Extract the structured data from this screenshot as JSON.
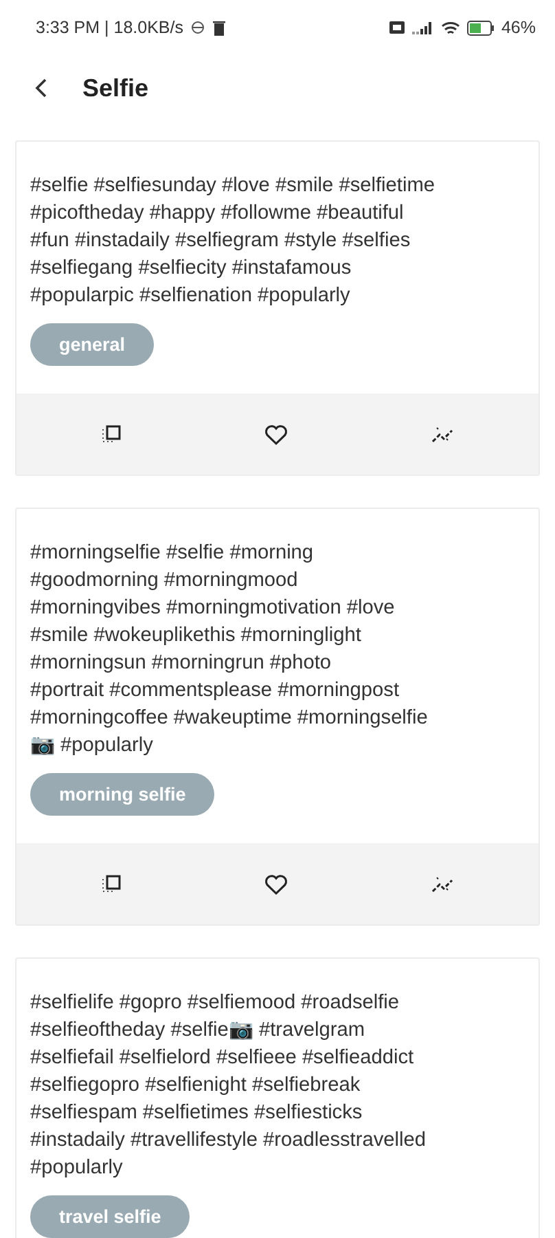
{
  "status_bar": {
    "time": "3:33 PM | 18.0KB/s",
    "battery": "46%"
  },
  "header": {
    "title": "Selfie"
  },
  "cards": [
    {
      "hashtags": " #selfie #selfiesunday #love #smile #selfietime\n#picoftheday #happy #followme #beautiful\n#fun #instadaily #selfiegram #style #selfies\n#selfiegang #selfiecity #instafamous\n#popularpic  #selfienation #popularly",
      "category": "general"
    },
    {
      "hashtags": " #morningselfie #selfie #morning\n#goodmorning #morningmood\n#morningvibes #morningmotivation #love\n#smile #wokeuplikethis #morninglight\n#morningsun #morningrun #photo\n#portrait #commentsplease #morningpost\n#morningcoffee #wakeuptime #morningselfie\n📷 #popularly",
      "category": "morning selfie"
    },
    {
      "hashtags": " #selfielife #gopro #selfiemood #roadselfie\n#selfieoftheday #selfie📷 #travelgram\n#selfiefail #selfielord #selfieee #selfieaddict\n#selfiegopro #selfienight #selfiebreak\n#selfiespam #selfietimes #selfiesticks\n#instadaily #travellifestyle #roadlesstravelled\n#popularly",
      "category": "travel selfie"
    }
  ]
}
